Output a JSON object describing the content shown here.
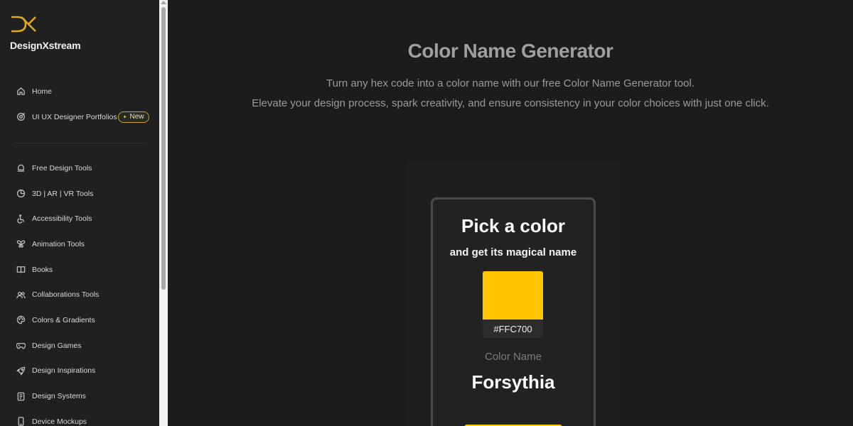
{
  "brand": {
    "name": "DesignXstream",
    "accent": "#E0A81F"
  },
  "sidebar": {
    "top_items": [
      {
        "label": "Home",
        "icon": "home-icon"
      },
      {
        "label": "UI UX Designer Portfolios",
        "icon": "target-icon",
        "badge": "New",
        "badge_icon": "star-icon"
      }
    ],
    "items": [
      {
        "label": "Free Design Tools",
        "icon": "bell-icon"
      },
      {
        "label": "3D | AR | VR Tools",
        "icon": "sphere-icon"
      },
      {
        "label": "Accessibility Tools",
        "icon": "wheelchair-icon"
      },
      {
        "label": "Animation Tools",
        "icon": "butterfly-icon"
      },
      {
        "label": "Books",
        "icon": "book-icon"
      },
      {
        "label": "Collaborations Tools",
        "icon": "users-icon"
      },
      {
        "label": "Colors & Gradients",
        "icon": "palette-icon"
      },
      {
        "label": "Design Games",
        "icon": "gamepad-icon"
      },
      {
        "label": "Design Inspirations",
        "icon": "rocket-icon"
      },
      {
        "label": "Design Systems",
        "icon": "notebook-icon"
      },
      {
        "label": "Device Mockups",
        "icon": "phone-icon"
      }
    ]
  },
  "main": {
    "title": "Color Name Generator",
    "subtitle_line1": "Turn any hex code into a color name with our free Color Name Generator tool.",
    "subtitle_line2": "Elevate your design process, spark creativity, and ensure consistency in your color choices with just one click."
  },
  "card": {
    "title": "Pick a color",
    "subtitle": "and get its magical name",
    "hex": "#FFC700",
    "swatch_color": "#FFC700",
    "color_name_label": "Color Name",
    "color_name": "Forsythia"
  }
}
